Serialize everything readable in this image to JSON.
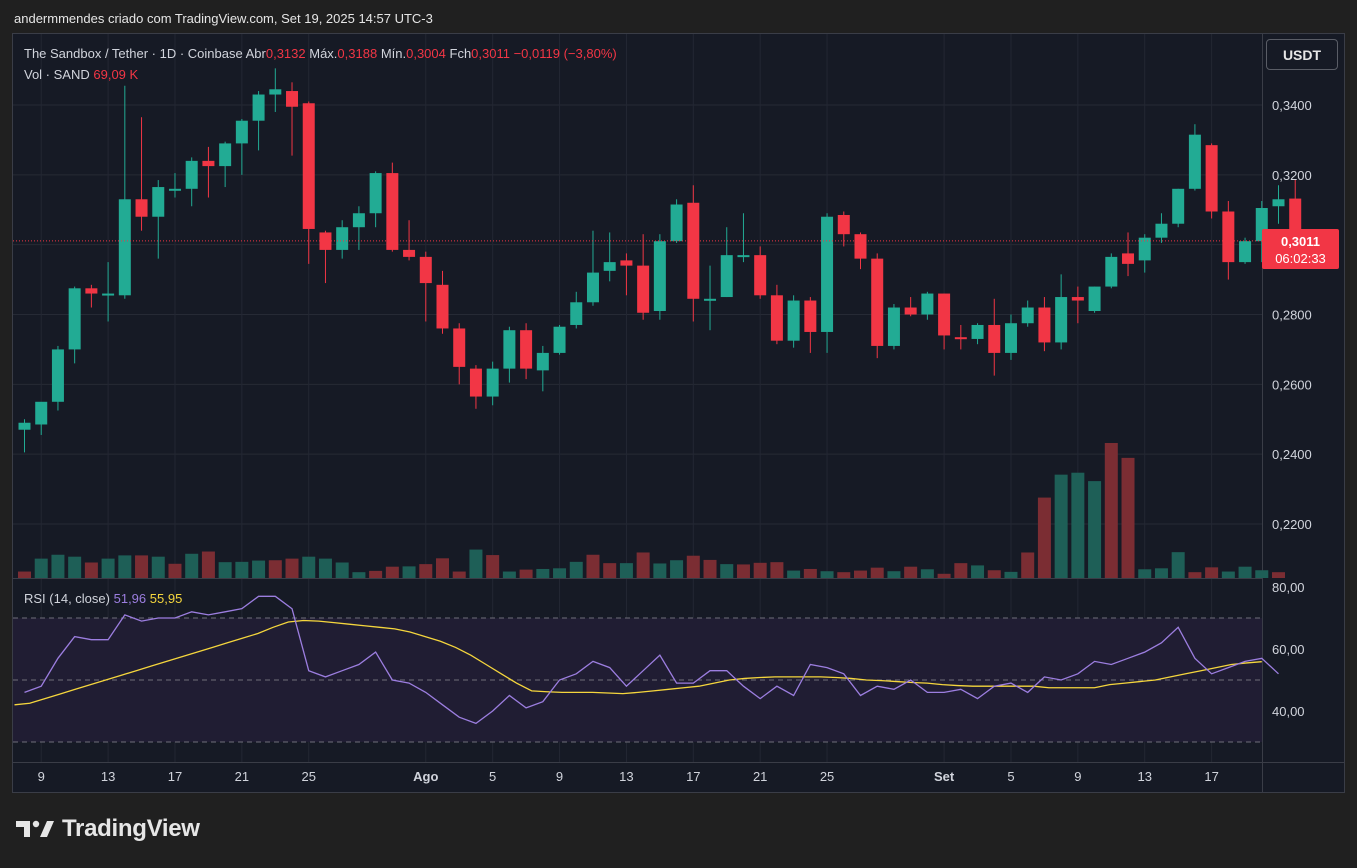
{
  "header": {
    "attribution": "andermmendes criado com TradingView.com, Set 19, 2025 14:57 UTC-3"
  },
  "legend": {
    "symbol": "The Sandbox / Tether · 1D · Coinbase",
    "open_label": "Abr",
    "open_value": "0,3132",
    "high_label": "Máx.",
    "high_value": "0,3188",
    "low_label": "Mín.",
    "low_value": "0,3004",
    "close_label": "Fch",
    "close_value": "0,3011",
    "change": "−0,0119 (−3,80%)",
    "volume_label": "Vol · SAND",
    "volume_value": "69,09 K",
    "rsi_label": "RSI (14, close)",
    "rsi_value": "51,96",
    "rsi_ma_value": "55,95"
  },
  "currency_button": "USDT",
  "price_tag": {
    "price": "0,3011",
    "countdown": "06:02:33"
  },
  "logo": {
    "text": "TradingView"
  },
  "colors": {
    "up": "#22ab94",
    "down": "#f23645",
    "rsi": "#9c7ee0",
    "rsi_ma": "#f5d63d",
    "background": "#161a25"
  },
  "chart_data": [
    {
      "type": "candlestick",
      "title": "The Sandbox / Tether · 1D · Coinbase",
      "y_ticks": [
        "0,3400",
        "0,3200",
        "0,2800",
        "0,2600",
        "0,2400",
        "0,2200"
      ],
      "y_tick_values": [
        0.34,
        0.32,
        0.28,
        0.26,
        0.24,
        0.22
      ],
      "ylim": [
        0.205,
        0.355
      ],
      "current_price": 0.3011,
      "x_ticks": [
        {
          "label": "9",
          "index": 1
        },
        {
          "label": "13",
          "index": 5
        },
        {
          "label": "17",
          "index": 9
        },
        {
          "label": "21",
          "index": 13
        },
        {
          "label": "25",
          "index": 17
        },
        {
          "label": "Ago",
          "index": 24
        },
        {
          "label": "5",
          "index": 28
        },
        {
          "label": "9",
          "index": 32
        },
        {
          "label": "13",
          "index": 36
        },
        {
          "label": "17",
          "index": 40
        },
        {
          "label": "21",
          "index": 44
        },
        {
          "label": "25",
          "index": 48
        },
        {
          "label": "Set",
          "index": 55
        },
        {
          "label": "5",
          "index": 59
        },
        {
          "label": "9",
          "index": 63
        },
        {
          "label": "13",
          "index": 67
        },
        {
          "label": "17",
          "index": 71
        }
      ],
      "ohlc": [
        [
          0.247,
          0.25,
          0.2405,
          0.249
        ],
        [
          0.2485,
          0.2515,
          0.2455,
          0.255
        ],
        [
          0.255,
          0.271,
          0.2525,
          0.27
        ],
        [
          0.27,
          0.288,
          0.266,
          0.2875
        ],
        [
          0.2875,
          0.2885,
          0.282,
          0.286
        ],
        [
          0.2855,
          0.295,
          0.278,
          0.286
        ],
        [
          0.2855,
          0.3455,
          0.2845,
          0.313
        ],
        [
          0.313,
          0.3365,
          0.304,
          0.308
        ],
        [
          0.308,
          0.3185,
          0.296,
          0.3165
        ],
        [
          0.3155,
          0.3205,
          0.3135,
          0.316
        ],
        [
          0.316,
          0.325,
          0.311,
          0.324
        ],
        [
          0.324,
          0.328,
          0.3135,
          0.3225
        ],
        [
          0.3225,
          0.3295,
          0.3165,
          0.329
        ],
        [
          0.329,
          0.336,
          0.32,
          0.3355
        ],
        [
          0.3355,
          0.344,
          0.327,
          0.343
        ],
        [
          0.343,
          0.3505,
          0.338,
          0.3445
        ],
        [
          0.344,
          0.3465,
          0.3255,
          0.3395
        ],
        [
          0.3405,
          0.341,
          0.2945,
          0.3045
        ],
        [
          0.3035,
          0.304,
          0.289,
          0.2985
        ],
        [
          0.2985,
          0.307,
          0.296,
          0.305
        ],
        [
          0.305,
          0.311,
          0.2985,
          0.309
        ],
        [
          0.309,
          0.321,
          0.305,
          0.3205
        ],
        [
          0.3205,
          0.3235,
          0.298,
          0.2985
        ],
        [
          0.2985,
          0.307,
          0.2955,
          0.2965
        ],
        [
          0.2965,
          0.298,
          0.278,
          0.289
        ],
        [
          0.2885,
          0.2925,
          0.2745,
          0.276
        ],
        [
          0.276,
          0.2775,
          0.26,
          0.265
        ],
        [
          0.2645,
          0.2655,
          0.253,
          0.2565
        ],
        [
          0.2565,
          0.2665,
          0.254,
          0.2645
        ],
        [
          0.2645,
          0.2765,
          0.2605,
          0.2755
        ],
        [
          0.2755,
          0.2775,
          0.2615,
          0.2645
        ],
        [
          0.264,
          0.271,
          0.258,
          0.269
        ],
        [
          0.269,
          0.277,
          0.2685,
          0.2765
        ],
        [
          0.277,
          0.2865,
          0.276,
          0.2835
        ],
        [
          0.2835,
          0.304,
          0.2825,
          0.292
        ],
        [
          0.2925,
          0.3035,
          0.2895,
          0.295
        ],
        [
          0.2955,
          0.2975,
          0.2855,
          0.294
        ],
        [
          0.294,
          0.303,
          0.2785,
          0.2805
        ],
        [
          0.281,
          0.303,
          0.2785,
          0.301
        ],
        [
          0.301,
          0.313,
          0.3005,
          0.3115
        ],
        [
          0.312,
          0.317,
          0.278,
          0.2845
        ],
        [
          0.2845,
          0.294,
          0.2755,
          0.2845
        ],
        [
          0.285,
          0.305,
          0.285,
          0.297
        ],
        [
          0.297,
          0.309,
          0.295,
          0.297
        ],
        [
          0.297,
          0.2995,
          0.2845,
          0.2855
        ],
        [
          0.2855,
          0.2885,
          0.2715,
          0.2725
        ],
        [
          0.2725,
          0.2855,
          0.2705,
          0.284
        ],
        [
          0.284,
          0.285,
          0.269,
          0.275
        ],
        [
          0.275,
          0.309,
          0.269,
          0.308
        ],
        [
          0.3085,
          0.3095,
          0.2995,
          0.303
        ],
        [
          0.303,
          0.3035,
          0.293,
          0.296
        ],
        [
          0.296,
          0.2975,
          0.2675,
          0.271
        ],
        [
          0.271,
          0.283,
          0.27,
          0.282
        ],
        [
          0.282,
          0.285,
          0.2795,
          0.28
        ],
        [
          0.28,
          0.2865,
          0.2785,
          0.286
        ],
        [
          0.286,
          0.286,
          0.27,
          0.274
        ],
        [
          0.2735,
          0.277,
          0.27,
          0.273
        ],
        [
          0.273,
          0.2775,
          0.2715,
          0.277
        ],
        [
          0.277,
          0.2845,
          0.2625,
          0.269
        ],
        [
          0.269,
          0.28,
          0.267,
          0.2775
        ],
        [
          0.2775,
          0.284,
          0.2765,
          0.282
        ],
        [
          0.282,
          0.285,
          0.2695,
          0.272
        ],
        [
          0.272,
          0.2915,
          0.27,
          0.285
        ],
        [
          0.285,
          0.288,
          0.2775,
          0.284
        ],
        [
          0.281,
          0.288,
          0.2805,
          0.288
        ],
        [
          0.288,
          0.2975,
          0.2875,
          0.2965
        ],
        [
          0.2975,
          0.3035,
          0.291,
          0.2945
        ],
        [
          0.2955,
          0.303,
          0.292,
          0.302
        ],
        [
          0.302,
          0.309,
          0.3005,
          0.306
        ],
        [
          0.306,
          0.316,
          0.305,
          0.316
        ],
        [
          0.316,
          0.3345,
          0.3155,
          0.3315
        ],
        [
          0.3285,
          0.329,
          0.3075,
          0.3095
        ],
        [
          0.3095,
          0.3125,
          0.29,
          0.295
        ],
        [
          0.295,
          0.302,
          0.2945,
          0.301
        ],
        [
          0.301,
          0.3125,
          0.295,
          0.3105
        ],
        [
          0.311,
          0.317,
          0.306,
          0.313
        ],
        [
          0.3132,
          0.3188,
          0.3004,
          0.3011
        ]
      ]
    },
    {
      "type": "bar",
      "title": "Vol · SAND",
      "values": [
        0.2,
        0.6,
        0.72,
        0.66,
        0.48,
        0.6,
        0.7,
        0.7,
        0.66,
        0.44,
        0.75,
        0.82,
        0.49,
        0.5,
        0.54,
        0.55,
        0.6,
        0.66,
        0.6,
        0.48,
        0.18,
        0.22,
        0.35,
        0.36,
        0.43,
        0.61,
        0.2,
        0.88,
        0.71,
        0.2,
        0.26,
        0.28,
        0.3,
        0.5,
        0.72,
        0.46,
        0.46,
        0.79,
        0.45,
        0.55,
        0.69,
        0.56,
        0.43,
        0.42,
        0.47,
        0.49,
        0.23,
        0.28,
        0.21,
        0.18,
        0.23,
        0.32,
        0.21,
        0.35,
        0.27,
        0.13,
        0.46,
        0.39,
        0.24,
        0.19,
        0.79,
        2.49,
        3.2,
        3.26,
        3.0,
        4.18,
        3.72,
        0.27,
        0.3,
        0.8,
        0.18,
        0.33,
        0.2,
        0.35,
        0.24,
        0.18
      ],
      "up_flags": [
        0,
        1,
        1,
        1,
        0,
        1,
        1,
        0,
        1,
        0,
        1,
        0,
        1,
        1,
        1,
        0,
        0,
        1,
        1,
        1,
        1,
        0,
        0,
        1,
        0,
        0,
        0,
        1,
        0,
        1,
        0,
        1,
        1,
        1,
        0,
        0,
        1,
        0,
        1,
        1,
        0,
        0,
        1,
        0,
        0,
        0,
        1,
        0,
        1,
        0,
        0,
        0,
        1,
        0,
        1,
        0,
        0,
        1,
        0,
        1,
        0,
        0,
        1,
        1,
        1,
        0,
        0,
        1,
        1,
        1,
        0,
        0,
        1,
        1,
        1,
        0
      ]
    },
    {
      "type": "line",
      "title": "RSI (14, close)",
      "y_ticks": [
        "80,00",
        "60,00",
        "40,00"
      ],
      "y_tick_values": [
        80,
        60,
        40
      ],
      "ylim": [
        29.5,
        82
      ],
      "bands": [
        70,
        50,
        30
      ],
      "series": [
        {
          "name": "RSI",
          "values": [
            46,
            48,
            57,
            64,
            63,
            63,
            71,
            69,
            70,
            70,
            72,
            71,
            72,
            73,
            77,
            77,
            73,
            53,
            51,
            53,
            55,
            59,
            50,
            49,
            46,
            42,
            38,
            36,
            40,
            45,
            41,
            43,
            50,
            52,
            56,
            54,
            48,
            53,
            58,
            49,
            49,
            53,
            53,
            48,
            44,
            48,
            45,
            55,
            54,
            52,
            45,
            48,
            47,
            50,
            46,
            46,
            47,
            44,
            48,
            49,
            46,
            51,
            50,
            52,
            56,
            55,
            57,
            59,
            62,
            67,
            57,
            52,
            54,
            56,
            57,
            52
          ]
        },
        {
          "name": "RSI MA",
          "values": [
            42,
            42.5,
            44,
            45.5,
            47,
            48.5,
            50,
            51.5,
            53,
            54.5,
            56,
            57.5,
            59,
            60.5,
            62,
            63.5,
            65,
            67,
            68.7,
            69.2,
            69,
            68.5,
            68,
            67.5,
            67,
            66.5,
            65.5,
            64,
            62.5,
            60.5,
            58,
            55,
            52,
            49,
            46.5,
            46.2,
            46,
            46,
            46,
            45.8,
            45.6,
            46,
            46.5,
            47,
            47.5,
            48,
            49,
            50,
            50.5,
            50.8,
            51,
            51,
            51,
            51,
            50.8,
            50.5,
            50,
            49.8,
            49.5,
            49.2,
            49,
            48.5,
            48.2,
            48,
            48,
            48,
            48,
            48,
            47.5,
            47.5,
            47.5,
            47.5,
            48.5,
            49,
            49.5,
            50,
            51,
            52,
            53,
            54,
            55,
            55.5,
            55.9
          ]
        }
      ]
    }
  ]
}
